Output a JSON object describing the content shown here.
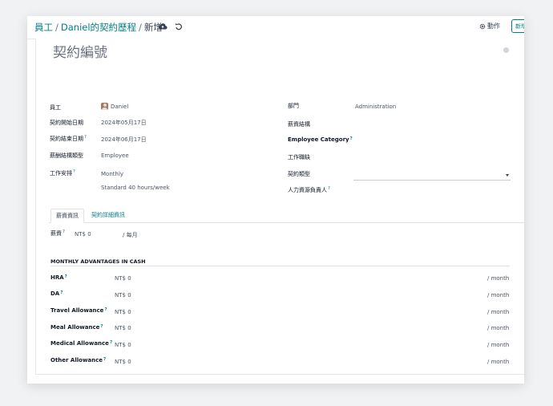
{
  "breadcrumb": {
    "root": "員工",
    "contract_history": "Daniel的契約歷程",
    "current": "新增",
    "separator": "/"
  },
  "toolbar": {
    "save_icon": "cloud-upload-icon",
    "discard_icon": "undo-icon",
    "action_label": "動作",
    "action_icon": "gear-icon",
    "new_label": "新增"
  },
  "form": {
    "title_placeholder": "契約編號",
    "left": [
      {
        "label": "員工",
        "value": "Daniel",
        "help": false
      },
      {
        "label": "契約開始日期",
        "value": "2024年05月17日",
        "help": false
      },
      {
        "label": "契約結束日期",
        "value": "2024年06月17日",
        "help": true
      },
      {
        "label": "薪酬結構類型",
        "value": "Employee",
        "help": false
      },
      {
        "label": "工作安排",
        "value": "Monthly",
        "value2": "Standard 40 hours/week",
        "help": true
      }
    ],
    "right": [
      {
        "label": "部門",
        "value": "Administration",
        "help": false,
        "bold": false
      },
      {
        "label": "薪資結構",
        "value": "",
        "help": false,
        "bold": false
      },
      {
        "label": "Employee Category",
        "value": "",
        "help": true,
        "bold": true
      },
      {
        "label": "工作職缺",
        "value": "",
        "help": false,
        "bold": false
      },
      {
        "label": "契約類型",
        "value": "",
        "help": false,
        "bold": false
      },
      {
        "label": "人力資源負責人",
        "value": "",
        "help": true,
        "bold": false
      }
    ],
    "help_mark": "?"
  },
  "tabs": [
    {
      "label": "薪資資訊",
      "active": true
    },
    {
      "label": "契約詳細資訊",
      "active": false
    }
  ],
  "salary": {
    "wage_label": "薪資",
    "wage_value": "NT$ 0",
    "wage_period": "/ 每月"
  },
  "advantages": {
    "title": "MONTHLY ADVANTAGES IN CASH",
    "suffix": "/ month",
    "rows": [
      {
        "label": "HRA",
        "value": "NT$ 0"
      },
      {
        "label": "DA",
        "value": "NT$ 0"
      },
      {
        "label": "Travel Allowance",
        "value": "NT$ 0"
      },
      {
        "label": "Meal Allowance",
        "value": "NT$ 0"
      },
      {
        "label": "Medical Allowance",
        "value": "NT$ 0"
      },
      {
        "label": "Other Allowance",
        "value": "NT$ 0"
      }
    ]
  },
  "colors": {
    "accent": "#017e84",
    "text": "#374151",
    "muted": "#6b7280",
    "background": "#f1f2f4"
  }
}
